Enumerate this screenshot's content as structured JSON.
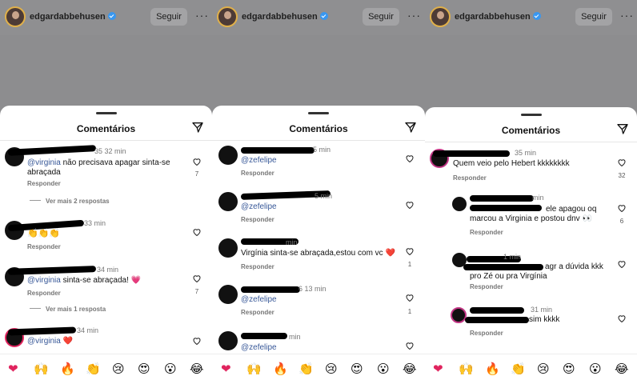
{
  "header": {
    "username": "edgardabbehusen",
    "follow_label": "Seguir",
    "more_label": "···"
  },
  "sheet": {
    "title": "Comentários"
  },
  "reactions": [
    "❤",
    "🙌",
    "🔥",
    "👏",
    "😢",
    "😍",
    "😮",
    "😂"
  ],
  "panels": [
    {
      "comments": [
        {
          "time": "35 32 min",
          "text_mention": "",
          "text": "@virginia não precisava apagar sinta-se abraçada",
          "reply": "Responder",
          "likes": "7",
          "more_replies": "Ver mais 2 respostas"
        },
        {
          "time": "elecildamedeiros 33 min",
          "text": "👏👏👏",
          "reply": "Responder",
          "likes": ""
        },
        {
          "time": "lho 34 min",
          "text_mention": "@virginia",
          "text": " sinta-se abraçada! 💗",
          "reply": "Responder",
          "likes": "7",
          "more_replies": "Ver mais 1 resposta"
        },
        {
          "time": "34 min",
          "text_mention": "@virginia",
          "text": " ❤️",
          "reply": "",
          "likes": ""
        }
      ]
    },
    {
      "comments": [
        {
          "time": "5 min",
          "text_mention": "@zefelipe",
          "text": "",
          "reply": "Responder",
          "likes": ""
        },
        {
          "time": "5 min",
          "text_mention": "@zefelipe",
          "text": "",
          "reply": "Responder",
          "likes": ""
        },
        {
          "time": "min",
          "text_mention": "",
          "text": "Virgínia sinta-se abraçada,estou com vc ❤️",
          "reply": "Responder",
          "likes": "1"
        },
        {
          "time": "6 13 min",
          "text_mention": "@zefelipe",
          "text": "",
          "reply": "Responder",
          "likes": "1"
        },
        {
          "time": "min",
          "text_mention": "@zefelipe",
          "text": "",
          "reply": "",
          "likes": ""
        }
      ]
    },
    {
      "comments": [
        {
          "time": "35 min",
          "text": "Quem veio pelo Hebert kkkkkkkk",
          "reply": "Responder",
          "likes": "32"
        },
        {
          "time": "min",
          "text": "ele apagou oq marcou a Virginia e postou dnv 👀",
          "reply": "Responder",
          "likes": "6"
        },
        {
          "time": "1 min",
          "text": "agr a dúvida kkk pro Zé ou pra Virgínia",
          "reply": "Responder",
          "likes": ""
        },
        {
          "time": "31 min",
          "text": "sim kkkk",
          "reply": "Responder",
          "likes": ""
        }
      ]
    }
  ]
}
